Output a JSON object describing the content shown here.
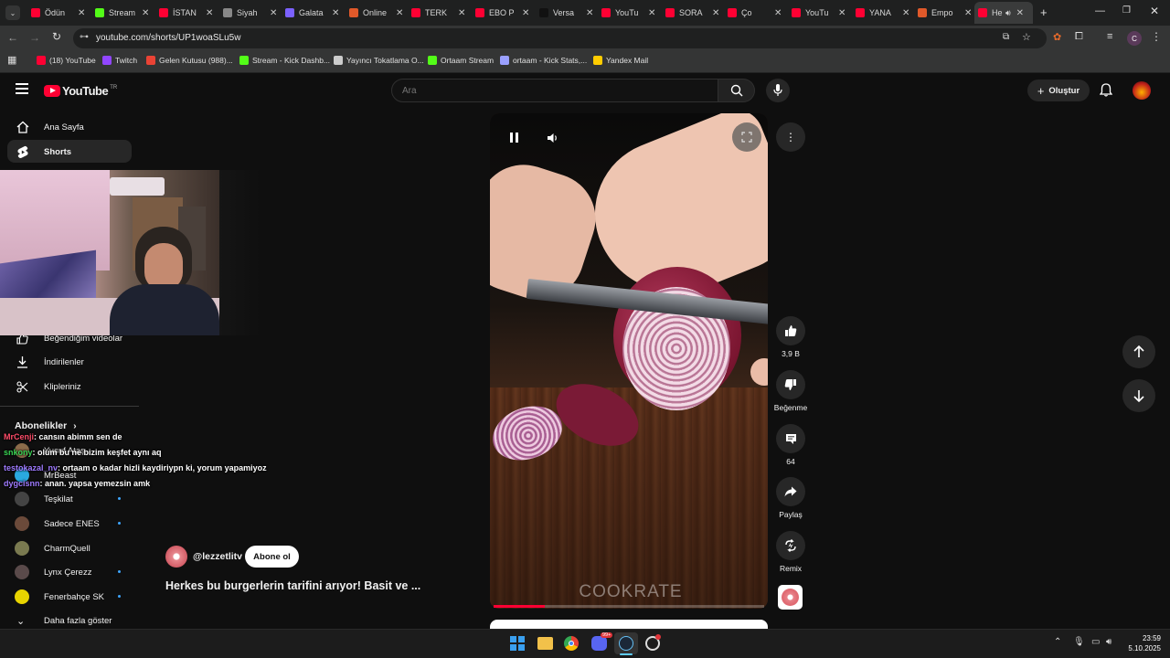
{
  "browser": {
    "tabs": [
      {
        "title": "Ödün",
        "color": "#ff0033"
      },
      {
        "title": "Stream",
        "color": "#53fc18"
      },
      {
        "title": "İSTAN",
        "color": "#ff0033"
      },
      {
        "title": "Siyah",
        "color": "#888888"
      },
      {
        "title": "Galata",
        "color": "#7b61ff"
      },
      {
        "title": "Online",
        "color": "#e0592a"
      },
      {
        "title": "TERK",
        "color": "#ff0033"
      },
      {
        "title": "EBO P",
        "color": "#ff0033"
      },
      {
        "title": "Versa",
        "color": "#111111"
      },
      {
        "title": "YouTu",
        "color": "#ff0033"
      },
      {
        "title": "SORA",
        "color": "#ff0033"
      },
      {
        "title": "Ço",
        "color": "#ff0033"
      },
      {
        "title": "YouTu",
        "color": "#ff0033"
      },
      {
        "title": "YANA",
        "color": "#ff0033"
      },
      {
        "title": "Empo",
        "color": "#e0592a"
      },
      {
        "title": "He",
        "color": "#ff0033"
      }
    ],
    "url": "youtube.com/shorts/UP1woaSLu5w",
    "profile_letter": "C",
    "bookmarks": [
      {
        "label": "(18) YouTube",
        "color": "#ff0033"
      },
      {
        "label": "Twitch",
        "color": "#9146ff"
      },
      {
        "label": "Gelen Kutusu (988)...",
        "color": "#ea4335"
      },
      {
        "label": "Stream - Kick Dashb...",
        "color": "#53fc18"
      },
      {
        "label": "Yayıncı Tokatlama O...",
        "color": "#cccccc"
      },
      {
        "label": "Ortaam Stream",
        "color": "#53fc18"
      },
      {
        "label": "ortaam - Kick Stats,...",
        "color": "#9aa0ff"
      },
      {
        "label": "Yandex Mail",
        "color": "#ffcc00"
      }
    ]
  },
  "youtube": {
    "logo_text": "YouTube",
    "logo_region": "TR",
    "search_placeholder": "Ara",
    "create_label": "Oluştur",
    "sidebar": {
      "home": "Ana Sayfa",
      "shorts": "Shorts",
      "liked": "Beğendiğim videolar",
      "downloads": "İndirilenler",
      "clips": "Klipleriniz",
      "subscriptions_title": "Abonelikler",
      "subscriptions": [
        {
          "name": "Yusuf Ataş",
          "color": "#8b6b4a"
        },
        {
          "name": "MrBeast",
          "color": "#2aa9e0"
        },
        {
          "name": "Teşkilat",
          "color": "#444444"
        },
        {
          "name": "Sadece ENES",
          "color": "#6b4a3a"
        },
        {
          "name": "CharmQuell",
          "color": "#7a7a50"
        },
        {
          "name": "Lynx Çerezz",
          "color": "#5a4a4a"
        },
        {
          "name": "Fenerbahçe SK",
          "color": "#e8d400"
        }
      ],
      "show_more": "Daha fazla göster"
    },
    "short": {
      "channel": "@lezzetlitv",
      "subscribe_label": "Abone ol",
      "title": "Herkes bu burgerlerin tarifini arıyor! Basit ve ...",
      "watermark": "COOKRATE",
      "progress": 0.19,
      "likes": "3,9 B",
      "dislike_label": "Beğenme",
      "comments": "64",
      "share_label": "Paylaş",
      "remix_label": "Remix"
    }
  },
  "chat": [
    {
      "user": "MrCenji",
      "message": ": cansın abimm sen de",
      "color": "#ff4d6a"
    },
    {
      "user": "snkony",
      "message": ": olum bu ne bizim keşfet aynı aq",
      "color": "#39d353"
    },
    {
      "user": "testokazal_nv",
      "message": ": ortaam o kadar hizli kaydiriypn ki, yorum yapamiyoz",
      "color": "#9f7bff"
    },
    {
      "user": "dygcisnn",
      "message": ": anan. yapsa yemezsin amk",
      "color": "#9f7bff"
    }
  ],
  "taskbar": {
    "time": "23:59",
    "date": "5.10.2025",
    "discord_badge": "99+"
  }
}
